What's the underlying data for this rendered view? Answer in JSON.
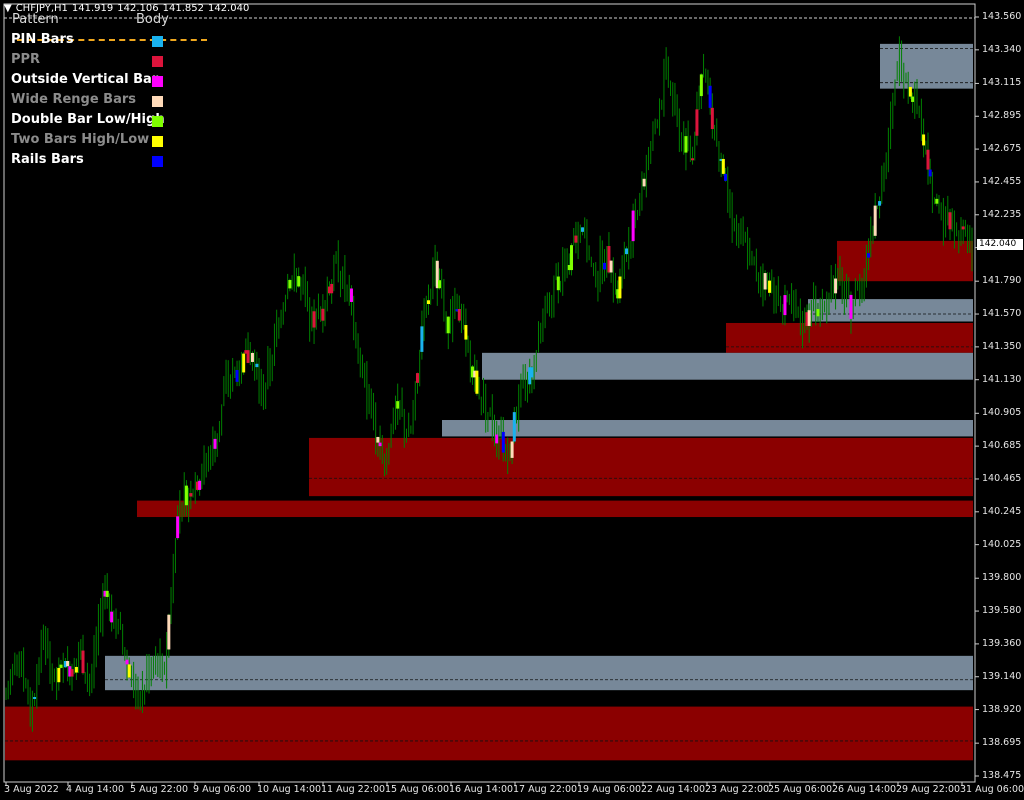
{
  "symbol": {
    "name": "CHFJPY,H1",
    "open": "141.919",
    "high": "142.106",
    "low": "141.852",
    "close": "142.040"
  },
  "legend": {
    "header_pattern": "Pattern",
    "header_body": "Body",
    "items": [
      {
        "label": "PIN Bars",
        "text_color": "#ffffff",
        "swatch": "#1ab2ee"
      },
      {
        "label": "PPR",
        "text_color": "#8c8c8c",
        "swatch": "#dc143c"
      },
      {
        "label": "Outside Vertical Bar",
        "text_color": "#ffffff",
        "swatch": "#ff00ff"
      },
      {
        "label": "Wide Renge Bars",
        "text_color": "#8c8c8c",
        "swatch": "#ffdab9"
      },
      {
        "label": "Double Bar Low/High",
        "text_color": "#ffffff",
        "swatch": "#7fff00"
      },
      {
        "label": "Two Bars High/Low",
        "text_color": "#8c8c8c",
        "swatch": "#ffff00"
      },
      {
        "label": "Rails Bars",
        "text_color": "#ffffff",
        "swatch": "#0000ff"
      }
    ]
  },
  "chart_data": {
    "type": "candlestick",
    "symbol": "CHFJPY",
    "timeframe": "H1",
    "ylim": [
      138.45,
      143.6
    ],
    "yticks": [
      "143.560",
      "143.340",
      "143.115",
      "142.895",
      "142.675",
      "142.455",
      "142.235",
      "142.015",
      "141.790",
      "141.570",
      "141.350",
      "141.130",
      "140.905",
      "140.685",
      "140.465",
      "140.245",
      "140.025",
      "139.800",
      "139.580",
      "139.360",
      "139.140",
      "138.920",
      "138.695",
      "138.475"
    ],
    "xticks": [
      "3 Aug 2022",
      "4 Aug 14:00",
      "5 Aug 22:00",
      "9 Aug 06:00",
      "10 Aug 14:00",
      "11 Aug 22:00",
      "15 Aug 06:00",
      "16 Aug 14:00",
      "17 Aug 22:00",
      "19 Aug 06:00",
      "22 Aug 14:00",
      "23 Aug 22:00",
      "25 Aug 06:00",
      "26 Aug 14:00",
      "29 Aug 22:00",
      "31 Aug 06:00"
    ],
    "last_price": "142.040",
    "bar_color": "#008000",
    "pattern_colors": {
      "PIN Bars": "#1ab2ee",
      "PPR": "#dc143c",
      "Outside Vertical Bar": "#ff00ff",
      "Wide Renge Bars": "#ffdab9",
      "Double Bar Low/High": "#7fff00",
      "Two Bars High/Low": "#ffff00",
      "Rails Bars": "#0000ff"
    },
    "zones": [
      {
        "kind": "supply",
        "color": "#778899",
        "x_start": "31 Aug 2022",
        "top": 143.38,
        "bottom": 143.08,
        "mid": [
          143.35,
          143.12
        ]
      },
      {
        "kind": "demand",
        "color": "#8b0000",
        "x_start": "30 Aug 2022",
        "top": 142.06,
        "bottom": 141.79,
        "mid": []
      },
      {
        "kind": "supply",
        "color": "#778899",
        "x_start": "25 Aug 2022",
        "top": 141.67,
        "bottom": 141.52,
        "mid": [
          141.57
        ]
      },
      {
        "kind": "demand",
        "color": "#8b0000",
        "x_start": "24 Aug 2022",
        "top": 141.51,
        "bottom": 141.31,
        "mid": [
          141.35
        ]
      },
      {
        "kind": "supply",
        "color": "#778899",
        "x_start": "16 Aug 2022",
        "top": 141.31,
        "bottom": 141.13,
        "mid": []
      },
      {
        "kind": "supply",
        "color": "#778899",
        "x_start": "15 Aug 2022",
        "top": 140.86,
        "bottom": 140.75,
        "mid": []
      },
      {
        "kind": "demand",
        "color": "#8b0000",
        "x_start": "11 Aug 2022",
        "top": 140.74,
        "bottom": 140.35,
        "mid": [
          140.47
        ]
      },
      {
        "kind": "demand",
        "color": "#8b0000",
        "x_start": "5 Aug 2022",
        "top": 140.32,
        "bottom": 140.21,
        "mid": []
      },
      {
        "kind": "supply",
        "color": "#778899",
        "x_start": "4 Aug 2022",
        "top": 139.28,
        "bottom": 139.05,
        "mid": [
          139.12
        ]
      },
      {
        "kind": "demand",
        "color": "#8b0000",
        "x_start": "3 Aug 2022",
        "top": 138.94,
        "bottom": 138.58,
        "mid": [
          138.71
        ]
      }
    ],
    "price_path": [
      139.0,
      139.35,
      138.9,
      139.4,
      139.1,
      139.2,
      139.3,
      139.1,
      139.75,
      139.5,
      139.2,
      139.0,
      139.3,
      139.2,
      140.3,
      140.4,
      140.5,
      140.7,
      141.1,
      141.2,
      141.3,
      141.0,
      141.4,
      141.8,
      141.8,
      141.5,
      141.6,
      141.9,
      141.7,
      141.2,
      140.9,
      140.6,
      141.0,
      140.7,
      141.4,
      141.9,
      141.5,
      141.6,
      141.2,
      141.0,
      140.8,
      140.6,
      141.0,
      141.2,
      141.5,
      141.8,
      141.9,
      142.2,
      141.8,
      142.0,
      141.7,
      142.1,
      142.4,
      142.8,
      143.2,
      142.8,
      142.6,
      143.2,
      142.8,
      142.3,
      142.1,
      141.9,
      141.8,
      141.7,
      141.6,
      141.5,
      141.6,
      141.7,
      141.8,
      141.6,
      141.8,
      142.2,
      142.6,
      143.3,
      143.1,
      142.8,
      142.3,
      142.2,
      142.1,
      142.0
    ]
  }
}
